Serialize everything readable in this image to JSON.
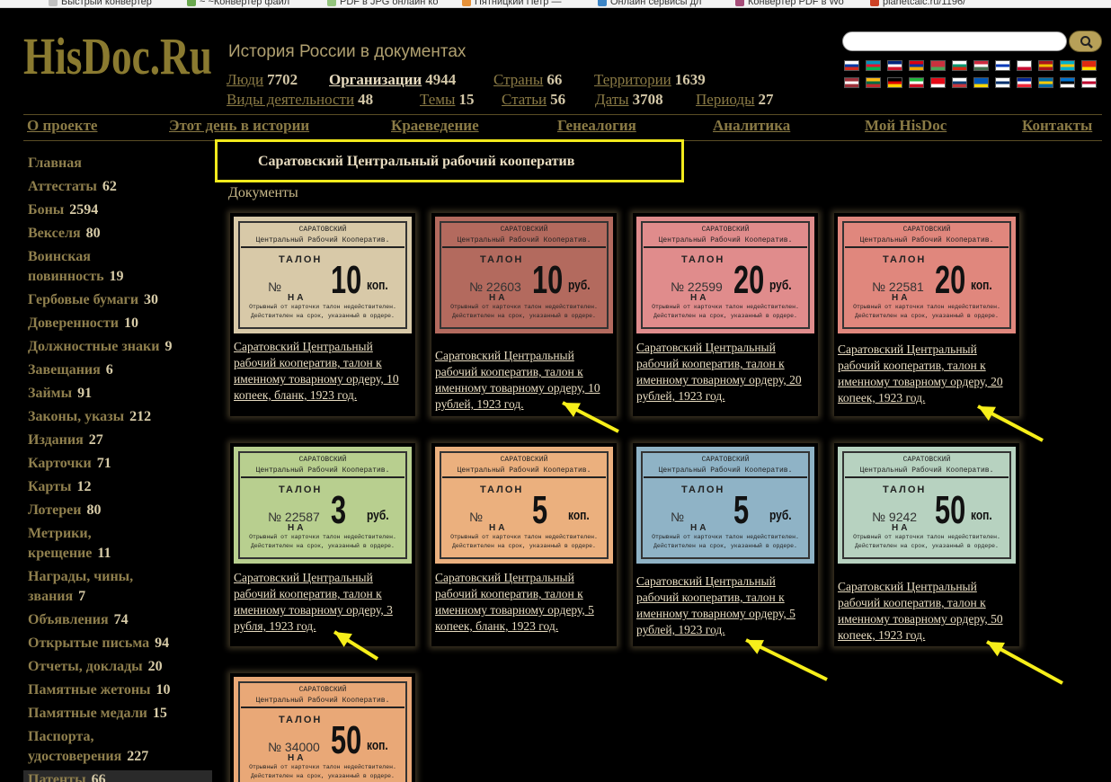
{
  "bookmarks": [
    {
      "label": "Быстрый конвертер",
      "color": "#c0c0c0"
    },
    {
      "label": "~ ~Конвертер файл",
      "color": "#6aa84f"
    },
    {
      "label": "PDF в JPG онлайн ко",
      "color": "#93c47d"
    },
    {
      "label": "Пятницкий Петр —",
      "color": "#e69138"
    },
    {
      "label": "Онлайн сервисы дл",
      "color": "#3d85c6"
    },
    {
      "label": "Конвертер PDF в Wo",
      "color": "#a64d79"
    },
    {
      "label": "planetcalc.ru/1196/",
      "color": "#cc4125"
    }
  ],
  "header": {
    "logo": "HisDoc.Ru",
    "tagline": "История России в документах",
    "stats": [
      {
        "label": "Люди",
        "value": "7702",
        "active": false
      },
      {
        "label": "Организации",
        "value": "4944",
        "active": true
      },
      {
        "label": "Страны",
        "value": "66",
        "active": false
      },
      {
        "label": "Территории",
        "value": "1639",
        "active": false
      },
      {
        "label": "Виды деятельности",
        "value": "48",
        "active": false
      },
      {
        "label": "Темы",
        "value": "15",
        "active": false
      },
      {
        "label": "Статьи",
        "value": "56",
        "active": false
      },
      {
        "label": "Даты",
        "value": "3708",
        "active": false
      },
      {
        "label": "Периоды",
        "value": "27",
        "active": false
      }
    ],
    "search_placeholder": ""
  },
  "flags_row1": [
    [
      "#ffffff",
      "#0039a6",
      "#d52b1e"
    ],
    [
      "#0092bc",
      "#e8112d",
      "#00b050"
    ],
    [
      "#00247d",
      "#ffffff",
      "#cf142b"
    ],
    [
      "#d90012",
      "#0033a0",
      "#f2a800"
    ],
    [
      "#c8313e",
      "#c8313e",
      "#4aa657"
    ],
    [
      "#ffffff",
      "#00966e",
      "#d62612"
    ],
    [
      "#cd2a3e",
      "#ffffff",
      "#436f4d"
    ],
    [
      "#ffffff",
      "#0038b8",
      "#ffffff"
    ],
    [
      "#ffffff",
      "#ffffff",
      "#c60c30"
    ],
    [
      "#aa151b",
      "#f1bf00",
      "#aa151b"
    ],
    [
      "#00afca",
      "#fec50c",
      "#00afca"
    ],
    [
      "#de2910",
      "#de2910",
      "#ffde00"
    ]
  ],
  "flags_row2": [
    [
      "#9e3039",
      "#ffffff",
      "#9e3039"
    ],
    [
      "#fdb913",
      "#006a44",
      "#c1272d"
    ],
    [
      "#000000",
      "#dd0000",
      "#ffce00"
    ],
    [
      "#1eb53a",
      "#ffffff",
      "#ce1126"
    ],
    [
      "#e30a17",
      "#e30a17",
      "#ffffff"
    ],
    [
      "#ffffff",
      "#0c4076",
      "#c6363c"
    ],
    [
      "#0057b7",
      "#0057b7",
      "#ffd700"
    ],
    [
      "#ffffff",
      "#002f6c",
      "#ffffff"
    ],
    [
      "#002395",
      "#ffffff",
      "#ed2939"
    ],
    [
      "#006aa7",
      "#fecc00",
      "#006aa7"
    ],
    [
      "#0072ce",
      "#000000",
      "#ffffff"
    ],
    [
      "#ffffff",
      "#bc002d",
      "#ffffff"
    ]
  ],
  "nav": [
    "О проекте",
    "Этот день в истории",
    "Краеведение",
    "Генеалогия",
    "Аналитика",
    "Мой HisDoc",
    "Контакты"
  ],
  "sidebar": [
    {
      "label": "Главная",
      "count": ""
    },
    {
      "label": "Аттестаты",
      "count": "62"
    },
    {
      "label": "Боны",
      "count": "2594"
    },
    {
      "label": "Векселя",
      "count": "80"
    },
    {
      "label": "Воинская",
      "count": ""
    },
    {
      "label": "повинность",
      "count": "19"
    },
    {
      "label": "Гербовые бумаги",
      "count": "30"
    },
    {
      "label": "Доверенности",
      "count": "10"
    },
    {
      "label": "Должностные знаки",
      "count": "9"
    },
    {
      "label": "Завещания",
      "count": "6"
    },
    {
      "label": "Займы",
      "count": "91"
    },
    {
      "label": "Законы, указы",
      "count": "212"
    },
    {
      "label": "Издания",
      "count": "27"
    },
    {
      "label": "Карточки",
      "count": "71"
    },
    {
      "label": "Карты",
      "count": "12"
    },
    {
      "label": "Лотереи",
      "count": "80"
    },
    {
      "label": "Метрики,",
      "count": ""
    },
    {
      "label": "крещение",
      "count": "11"
    },
    {
      "label": "Награды, чины,",
      "count": ""
    },
    {
      "label": "звания",
      "count": "7"
    },
    {
      "label": "Объявления",
      "count": "74"
    },
    {
      "label": "Открытые письма",
      "count": "94"
    },
    {
      "label": "Отчеты, доклады",
      "count": "20"
    },
    {
      "label": "Памятные жетоны",
      "count": "10"
    },
    {
      "label": "Памятные медали",
      "count": "15"
    },
    {
      "label": "Паспорта,",
      "count": ""
    },
    {
      "label": "удостоверения",
      "count": "227"
    },
    {
      "label": "Патенты",
      "count": "66"
    }
  ],
  "page": {
    "title": "Саратовский Центральный рабочий кооператив",
    "docs_label": "Документы"
  },
  "ticket_text": {
    "top": "САРАТОВСКИЙ",
    "sub": "Центральный Рабочий Кооператив.",
    "talon": "ТАЛОН",
    "na": "НА",
    "foot1": "Отрывный от карточки талон недействителен.",
    "foot2": "Действителен на срок, указанный в ордере."
  },
  "documents": [
    {
      "caption": "Саратовский Центральный рабочий кооператив, талон к именному товарному ордеру, 10 копеек, бланк, 1923 год.",
      "big": "10",
      "unit": "коп.",
      "num": "",
      "bg": "#d8c9a8",
      "arrow": false
    },
    {
      "caption": "Саратовский Центральный рабочий кооператив, талон к именному товарному ордеру, 10 рублей, 1923 год.",
      "big": "10",
      "unit": "руб.",
      "num": "22603",
      "bg": "#b36a5e",
      "arrow": true
    },
    {
      "caption": "Саратовский Центральный рабочий кооператив, талон к именному товарному ордеру, 20 рублей, 1923 год.",
      "big": "20",
      "unit": "руб.",
      "num": "22599",
      "bg": "#e08c8c",
      "arrow": false
    },
    {
      "caption": "Саратовский Центральный рабочий кооператив, талон к именному товарному ордеру, 20 копеек, 1923 год.",
      "big": "20",
      "unit": "коп.",
      "num": "22581",
      "bg": "#e0877d",
      "arrow": true
    },
    {
      "caption": "Саратовский Центральный рабочий кооператив, талон к именному товарному ордеру, 3 рубля, 1923 год.",
      "big": "3",
      "unit": "руб.",
      "num": "22587",
      "bg": "#b8cf8f",
      "arrow": true
    },
    {
      "caption": "Саратовский Центральный рабочий кооператив, талон к именному товарному ордеру, 5 копеек, бланк, 1923 год.",
      "big": "5",
      "unit": "коп.",
      "num": "",
      "bg": "#ebb07e",
      "arrow": false
    },
    {
      "caption": "Саратовский Центральный рабочий кооператив, талон к именному товарному ордеру, 5 рублей, 1923 год.",
      "big": "5",
      "unit": "руб.",
      "num": "",
      "bg": "#8fb3c6",
      "arrow": true
    },
    {
      "caption": "Саратовский Центральный рабочий кооператив, талон к именному товарному ордеру, 50 копеек, 1923 год.",
      "big": "50",
      "unit": "коп.",
      "num": "9242",
      "bg": "#b7d2c0",
      "arrow": true
    },
    {
      "caption": "",
      "big": "50",
      "unit": "коп.",
      "num": "34000",
      "bg": "#e9a877",
      "arrow": false
    }
  ]
}
